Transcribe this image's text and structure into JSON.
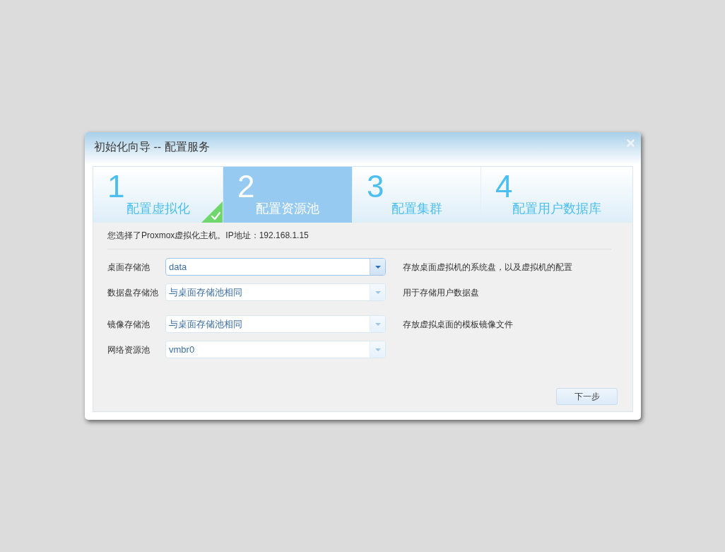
{
  "window": {
    "title": "初始化向导 -- 配置服务"
  },
  "steps": [
    {
      "number": "1",
      "label": "配置虚拟化",
      "selected": false,
      "completed": true
    },
    {
      "number": "2",
      "label": "配置资源池",
      "selected": true,
      "completed": false
    },
    {
      "number": "3",
      "label": "配置集群",
      "selected": false,
      "completed": false
    },
    {
      "number": "4",
      "label": "配置用户数据库",
      "selected": false,
      "completed": false
    }
  ],
  "info": "您选择了Proxmox虚拟化主机。IP地址：192.168.1.15",
  "fields": [
    {
      "label": "桌面存储池",
      "value": "data",
      "description": "存放桌面虚拟机的系统盘，以及虚拟机的配置",
      "focused": true
    },
    {
      "label": "数据盘存储池",
      "value": "与桌面存储池相同",
      "description": "用于存储用户数据盘",
      "focused": false
    },
    {
      "label": "镜像存储池",
      "value": "与桌面存储池相同",
      "description": "存放虚拟桌面的模板镜像文件",
      "focused": false
    },
    {
      "label": "网络资源池",
      "value": "vmbr0",
      "focused": false
    }
  ],
  "buttons": [
    {
      "label": "下一步"
    }
  ]
}
